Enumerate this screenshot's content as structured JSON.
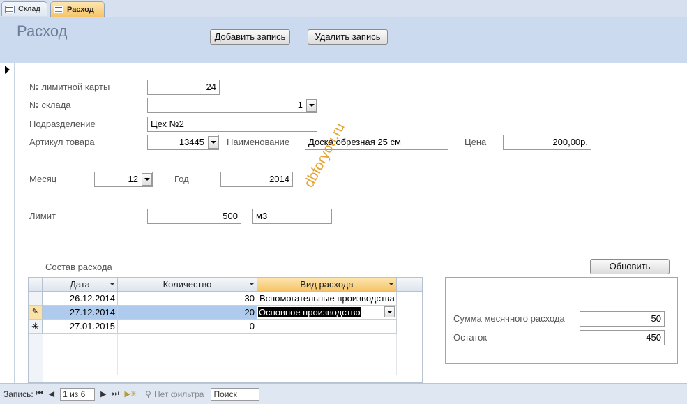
{
  "tabs": [
    {
      "label": "Склад",
      "active": false
    },
    {
      "label": "Расход",
      "active": true
    }
  ],
  "header": {
    "title": "Расход",
    "add_button": "Добавить запись",
    "delete_button": "Удалить запись"
  },
  "form": {
    "limit_card_label": "№ лимитной карты",
    "limit_card_value": "24",
    "warehouse_label": "№ склада",
    "warehouse_value": "1",
    "division_label": "Подразделение",
    "division_value": "Цех №2",
    "article_label": "Артикул товара",
    "article_value": "13445",
    "name_label": "Наименование",
    "name_value": "Доска обрезная 25 см",
    "price_label": "Цена",
    "price_value": "200,00р.",
    "month_label": "Месяц",
    "month_value": "12",
    "year_label": "Год",
    "year_value": "2014",
    "limit_label": "Лимит",
    "limit_value": "500",
    "unit_value": "м3"
  },
  "watermark": "dbforyou.ru",
  "subform": {
    "label": "Состав расхода",
    "columns": [
      "Дата",
      "Количество",
      "Вид расхода"
    ],
    "rows": [
      {
        "date": "26.12.2014",
        "qty": "30",
        "type": "Вспомогательные производства"
      },
      {
        "date": "27.12.2014",
        "qty": "20",
        "type": "Основное производство"
      },
      {
        "date": "27.01.2015",
        "qty": "0",
        "type": ""
      }
    ]
  },
  "summary": {
    "refresh_button": "Обновить",
    "monthly_sum_label": "Сумма месячного расхода",
    "monthly_sum_value": "50",
    "remainder_label": "Остаток",
    "remainder_value": "450"
  },
  "status": {
    "record_label": "Запись:",
    "record_position": "1 из 6",
    "filter_label": "Нет фильтра",
    "search_label": "Поиск"
  }
}
